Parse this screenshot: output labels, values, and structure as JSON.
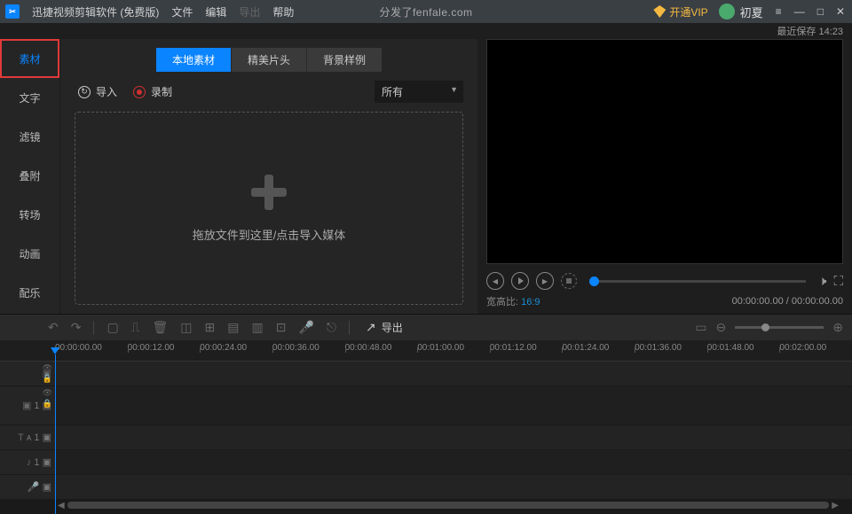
{
  "titlebar": {
    "app_title": "迅捷视频剪辑软件 (免费版)",
    "center_text": "分发了fenfale.com",
    "menus": [
      "文件",
      "编辑",
      "导出",
      "帮助"
    ],
    "vip_label": "开通VIP",
    "user_name": "初夏"
  },
  "status": {
    "last_save": "最近保存 14:23"
  },
  "side_tabs": [
    "素材",
    "文字",
    "滤镜",
    "叠附",
    "转场",
    "动画",
    "配乐"
  ],
  "sub_tabs": [
    "本地素材",
    "精美片头",
    "背景样例"
  ],
  "actions": {
    "import_label": "导入",
    "record_label": "录制",
    "filter_selected": "所有"
  },
  "dropzone": {
    "text": "拖放文件到这里/点击导入媒体"
  },
  "preview": {
    "aspect_label": "宽高比:",
    "aspect_value": "16:9",
    "time_current": "00:00:00.00",
    "time_total": "00:00:00.00"
  },
  "toolbar": {
    "export_label": "导出"
  },
  "timeline": {
    "marks": [
      "00:00:00.00",
      "00:00:12.00",
      "00:00:24.00",
      "00:00:36.00",
      "00:00:48.00",
      "00:01:00.00",
      "00:01:12.00",
      "00:01:24.00",
      "00:01:36.00",
      "00:01:48.00",
      "00:02:00.00"
    ]
  }
}
